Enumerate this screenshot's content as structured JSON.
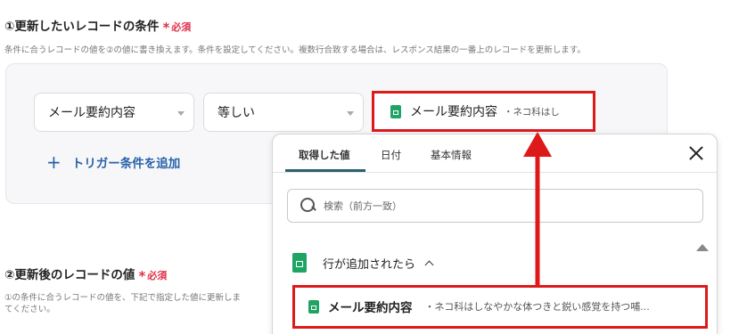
{
  "section1": {
    "title": "①更新したいレコードの条件",
    "required": "必須",
    "description": "条件に合うレコードの値を②の値に書き換えます。条件を設定してください。複数行合致する場合は、レスポンス結果の一番上のレコードを更新します。"
  },
  "condition": {
    "field_select": "メール要約内容",
    "operator_select": "等しい",
    "value_label": "メール要約内容",
    "value_preview": "・ネコ科はし",
    "add_trigger": "トリガー条件を追加"
  },
  "section2": {
    "title": "②更新後のレコードの値",
    "required": "必須",
    "description_line1": "①の条件に合うレコードの値を、下記で指定した値に更新しま",
    "description_line2": "てください。"
  },
  "dropdown": {
    "tabs": [
      "取得した値",
      "日付",
      "基本情報"
    ],
    "active_tab": 0,
    "search_placeholder": "検索（前方一致）",
    "group_label": "行が追加されたら",
    "item_label": "メール要約内容",
    "item_preview": "・ネコ科はしなやかな体つきと鋭い感覚を持つ哺..."
  },
  "colors": {
    "required": "#e0304a",
    "link": "#2662a8",
    "highlight": "#dd1a1a",
    "sheets_green": "#1fa463",
    "tab_underline": "#2a6170"
  },
  "icons": [
    "sheets-icon",
    "plus-icon",
    "search-icon",
    "close-icon",
    "chevron-up-icon",
    "scroll-up-icon",
    "caret-down-icon"
  ]
}
